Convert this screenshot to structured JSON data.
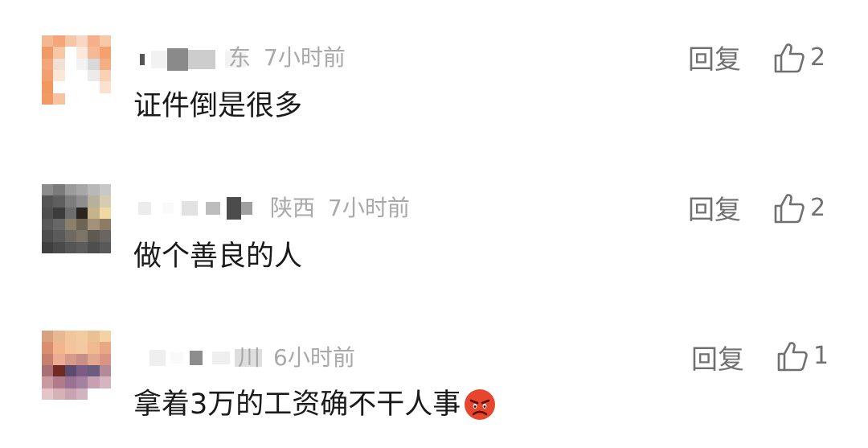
{
  "comments": [
    {
      "location": "广东",
      "location_partial": "东",
      "time": "7小时前",
      "text": "证件倒是很多",
      "reply_label": "回复",
      "likes": "2"
    },
    {
      "location": "陕西",
      "location_partial": "陕西",
      "time": "7小时前",
      "text": "做个善良的人",
      "reply_label": "回复",
      "likes": "2"
    },
    {
      "location": "四川",
      "location_partial": "川",
      "time": "6小时前",
      "text": "拿着3万的工资确不干人事",
      "emoji": "angry-face-emoji",
      "reply_label": "回复",
      "likes": "1"
    }
  ],
  "icons": {
    "like": "thumbs-up-icon",
    "emoji": "angry-face-emoji"
  },
  "colors": {
    "text": "#1a1a1a",
    "meta": "#a9a9a9",
    "action": "#707070",
    "emoji": "#e8452f"
  }
}
